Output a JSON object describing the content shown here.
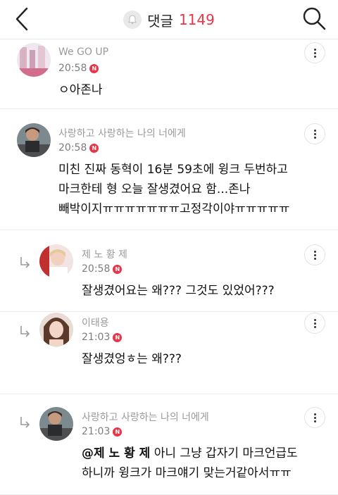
{
  "header": {
    "back_icon": "chevron-left-icon",
    "bell_icon": "bell-icon",
    "title": "댓글",
    "count": "1149",
    "search_icon": "search-icon",
    "accent_color": "#e8354a"
  },
  "comments": [
    {
      "name": "We GO UP",
      "time": "20:58",
      "badge": "N",
      "text": "ㅇ아존나",
      "reply": false
    },
    {
      "name": "사랑하고 사랑하는 나의 너에게",
      "time": "20:58",
      "badge": "N",
      "text": "미친 진짜 동혁이 16분 59초에 윙크 두번하고\n마크한테 형 오늘 잘생겼어요 함...존나\n빼박이지ㅠㅠㅠㅠㅠㅠㅠ고정각이야ㅠㅠㅠㅠㅠ",
      "reply": false
    },
    {
      "name": "제 노 황 제",
      "time": "20:58",
      "badge": "N",
      "text": "잘생겼어요는 왜??? 그것도 있었어???",
      "reply": true
    },
    {
      "name": "이태용",
      "time": "21:03",
      "badge": "N",
      "text": "잘생겼엉ㅎ는 왜???",
      "reply": true
    },
    {
      "name": "사랑하고 사랑하는 나의 너에게",
      "time": "21:03",
      "badge": "N",
      "mention": "@제 노 황 제",
      "text": " 아니 그냥 갑자기 마크언급도\n하니까 윙크가 마크얘기 맞는거같아서ㅠㅠ",
      "reply": true
    }
  ]
}
